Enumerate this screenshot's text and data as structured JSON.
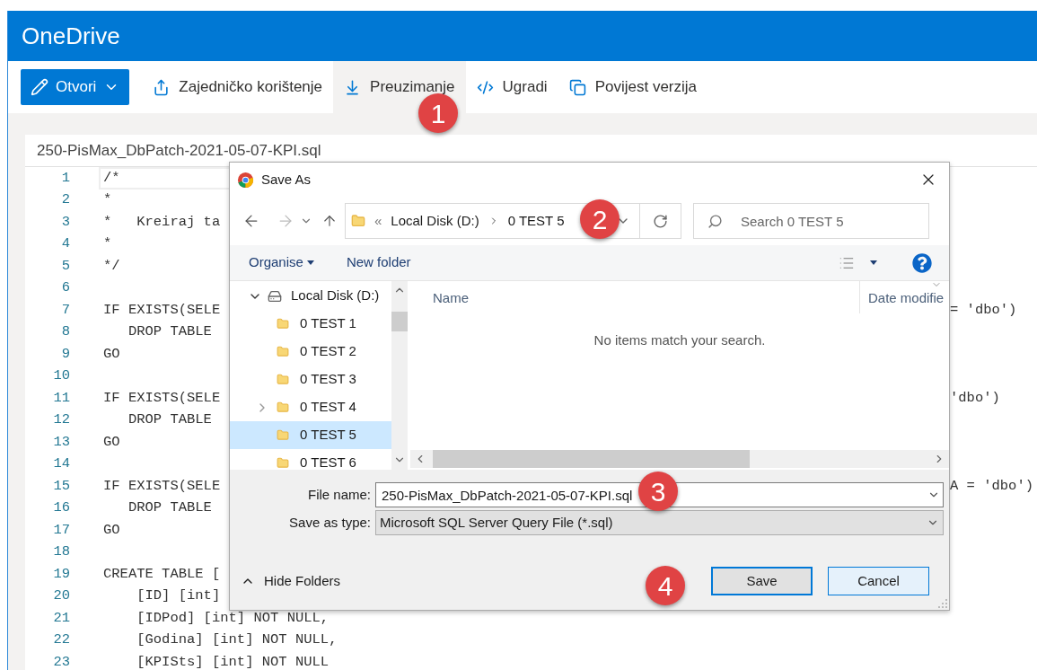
{
  "app": {
    "title": "OneDrive"
  },
  "toolbar": {
    "open_button": {
      "label": "Otvori"
    },
    "items": [
      {
        "kind": "share",
        "label": "Zajedničko korištenje",
        "hovered": false
      },
      {
        "kind": "download",
        "label": "Preuzimanje",
        "hovered": true,
        "marker": "1"
      },
      {
        "kind": "embed",
        "label": "Ugradi",
        "hovered": false
      },
      {
        "kind": "history",
        "label": "Povijest verzija",
        "hovered": false
      }
    ]
  },
  "editor": {
    "file_name": "250-PisMax_DbPatch-2021-05-07-KPI.sql",
    "lines": [
      {
        "number": "1",
        "text": "/*",
        "current": true
      },
      {
        "number": "2",
        "text": "*",
        "current": false
      },
      {
        "number": "3",
        "text": "*   Kreiraj ta",
        "current": false
      },
      {
        "number": "4",
        "text": "*",
        "current": false
      },
      {
        "number": "5",
        "text": "*/",
        "current": false
      },
      {
        "number": "6",
        "current": false
      },
      {
        "number": "7",
        "text": "IF EXISTS(SELE",
        "tail": "= 'dbo')",
        "current": false
      },
      {
        "number": "8",
        "text": "   DROP TABLE",
        "current": false
      },
      {
        "number": "9",
        "text": "GO",
        "current": false
      },
      {
        "number": "10",
        "current": false
      },
      {
        "number": "11",
        "text": "IF EXISTS(SELE",
        "tail": "'dbo')",
        "current": false
      },
      {
        "number": "12",
        "text": "   DROP TABLE",
        "current": false
      },
      {
        "number": "13",
        "text": "GO",
        "current": false
      },
      {
        "number": "14",
        "current": false
      },
      {
        "number": "15",
        "text": "IF EXISTS(SELE",
        "tail": "A = 'dbo')",
        "current": false
      },
      {
        "number": "16",
        "text": "   DROP TABLE",
        "current": false
      },
      {
        "number": "17",
        "text": "GO",
        "current": false
      },
      {
        "number": "18",
        "current": false
      },
      {
        "number": "19",
        "text": "CREATE TABLE [",
        "current": false
      },
      {
        "number": "20",
        "text": "    [ID] [int]",
        "current": false
      },
      {
        "number": "21",
        "text": "    [IDPod] [int] NOT NULL,",
        "current": false
      },
      {
        "number": "22",
        "text": "    [Godina] [int] NOT NULL,",
        "current": false
      },
      {
        "number": "23",
        "text": "    [KPISts] [int] NOT NULL",
        "current": false
      }
    ]
  },
  "dialog": {
    "title": "Save As",
    "address": {
      "overflow": "«",
      "segments": [
        "Local Disk (D:)",
        "0 TEST 5"
      ],
      "marker": "2"
    },
    "search": {
      "placeholder": "Search 0 TEST 5"
    },
    "commands": {
      "organise": "Organise",
      "new_folder": "New folder"
    },
    "tree": [
      {
        "kind": "drive",
        "label": "Local Disk (D:)",
        "expandable": true,
        "expanded": true,
        "selected": false,
        "children": [
          {
            "kind": "folder",
            "label": "0 TEST 1",
            "expandable": false,
            "expanded": false,
            "selected": false
          },
          {
            "kind": "folder",
            "label": "0 TEST 2",
            "expandable": false,
            "expanded": false,
            "selected": false
          },
          {
            "kind": "folder",
            "label": "0 TEST 3",
            "expandable": false,
            "expanded": false,
            "selected": false
          },
          {
            "kind": "folder",
            "label": "0 TEST 4",
            "expandable": true,
            "expanded": false,
            "selected": false
          },
          {
            "kind": "folder",
            "label": "0 TEST 5",
            "expandable": false,
            "expanded": false,
            "selected": true
          },
          {
            "kind": "folder",
            "label": "0 TEST 6",
            "expandable": false,
            "expanded": false,
            "selected": false
          }
        ]
      }
    ],
    "columns": [
      "Name",
      "Date modifie"
    ],
    "empty_message": "No items match your search.",
    "file_name": {
      "label": "File name:",
      "value": "250-PisMax_DbPatch-2021-05-07-KPI.sql",
      "marker": "3"
    },
    "save_type": {
      "label": "Save as type:",
      "value": "Microsoft SQL Server Query File (*.sql)"
    },
    "hide_folders": "Hide Folders",
    "buttons_marker": "4",
    "buttons": [
      {
        "label": "Save",
        "default": true
      },
      {
        "label": "Cancel",
        "default": false
      }
    ]
  }
}
